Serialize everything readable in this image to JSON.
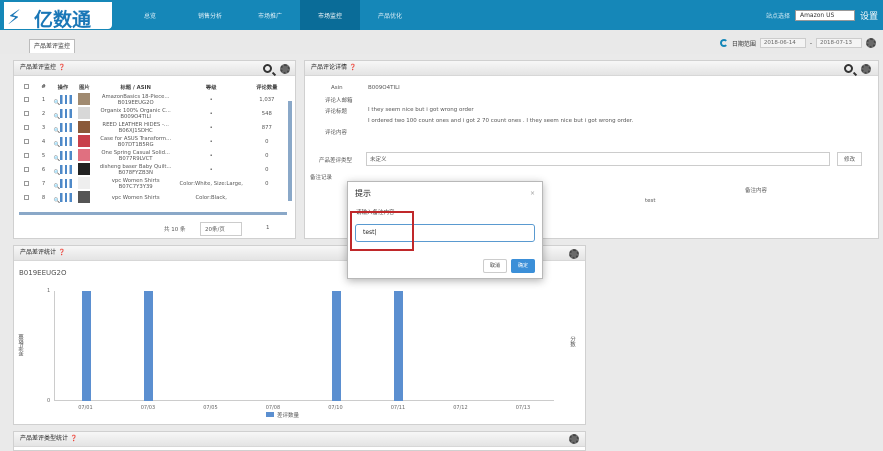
{
  "brand": {
    "name": "亿数通"
  },
  "nav": [
    "总览",
    "销售分析",
    "市场推广",
    "市场监控",
    "产品优化"
  ],
  "nav_active": 3,
  "header": {
    "market_label": "站点选择",
    "market_value": "Amazon US",
    "settings": "设置"
  },
  "tab": "产品差评监控",
  "date": {
    "label": "日期范围",
    "start": "2018-06-14",
    "end": "2018-07-13"
  },
  "left_panel": {
    "title": "产品差评监控",
    "columns": [
      "#",
      "操作",
      "图片",
      "标题 / ASIN",
      "等级",
      "评论数量"
    ],
    "rows": [
      {
        "n": "1",
        "title": "AmazonBasics 18-Piece...",
        "asin": "B019EEUG2O",
        "grade": "•",
        "count": "1,037"
      },
      {
        "n": "2",
        "title": "Organix 100% Organic C...",
        "asin": "B009O4TILI",
        "grade": "•",
        "count": "548"
      },
      {
        "n": "3",
        "title": "REED LEATHER HIDES -...",
        "asin": "B06XJ1SDHC",
        "grade": "•",
        "count": "877"
      },
      {
        "n": "4",
        "title": "Case for ASUS Transform...",
        "asin": "B07DT1B5RG",
        "grade": "•",
        "count": "0"
      },
      {
        "n": "5",
        "title": "One Spring Casual Solid...",
        "asin": "B077R9LVCT",
        "grade": "•",
        "count": "0"
      },
      {
        "n": "6",
        "title": "disheng baser Baby Quilt...",
        "asin": "B078FYZB3N",
        "grade": "•",
        "count": "0"
      },
      {
        "n": "7",
        "title": "vpc Women Shirts",
        "asin": "B07C7Y3Y39",
        "grade": "Color:White, Size:Large,",
        "count": "0"
      },
      {
        "n": "8",
        "title": "vpc Women Shirts",
        "asin": "",
        "grade": "Color:Black,",
        "count": ""
      }
    ],
    "footer_total": "共 10 条",
    "page_size": "20条/页",
    "page": "1"
  },
  "right_panel": {
    "title": "产品评论详情",
    "labels": {
      "asin": "Asin",
      "reviewer": "评论人邮箱",
      "review_title": "评论标题",
      "review_content": "评论内容",
      "type": "产品差评类型"
    },
    "asin": "B009O4TILI",
    "review_title": "I they seem nice but i got wrong order",
    "review_content": "I ordered two 100 count ones and i got 2 70 count ones . I they seem nice but i got wrong order.",
    "type_value": "未定义",
    "modify_btn": "修改",
    "notes_title": "备注记录",
    "notes_column": "备注内容",
    "note_value": "test"
  },
  "chart_panel": {
    "title": "产品差评统计",
    "asin": "B019EEUG2O",
    "ylabel": "差评数量",
    "y2label": "分数",
    "legend": "差评数量"
  },
  "chart_data": {
    "type": "bar",
    "categories": [
      "07/01",
      "07/03",
      "07/05",
      "07/08",
      "07/10",
      "07/11",
      "07/12",
      "07/13"
    ],
    "values": [
      1,
      1,
      0,
      0,
      1,
      1,
      0,
      0
    ],
    "ylim": [
      0,
      1
    ],
    "yticks": [
      "0",
      "1"
    ]
  },
  "bottom_panel": {
    "title": "产品差评类型统计"
  },
  "modal": {
    "title": "提示",
    "close": "×",
    "prompt": "请输入备注内容",
    "input_value": "test|",
    "cancel": "取消",
    "ok": "确定"
  }
}
